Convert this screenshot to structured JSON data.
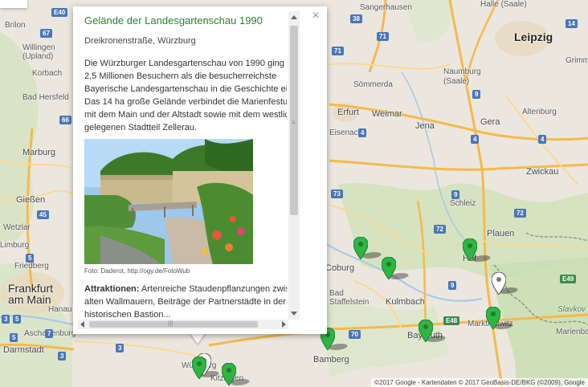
{
  "map": {
    "cities_major": [
      "Leipzig",
      "Frankfurt am Main"
    ],
    "cities": [
      "Erfurt",
      "Weimar",
      "Jena",
      "Gera",
      "Zwickau",
      "Plauen",
      "Hof",
      "Coburg",
      "Kulmbach",
      "Bayreuth",
      "Bamberg",
      "Marburg",
      "Gießen",
      "Darmstadt",
      "Naumburg (Saale)",
      "Halle (Saale)",
      "Sangerhausen",
      "Grimma",
      "Altenburg",
      "Marktredwitz",
      "Kitzingen",
      "Würzburg",
      "Brilon",
      "Willingen (Upland)",
      "Korbach",
      "Bad Staffelstein",
      "Friedberg",
      "Hanau",
      "Wetzlar",
      "Limburg",
      "Aschaffenburg",
      "Marienbad",
      "Slavkov",
      "Bad Hersfeld",
      "Eisenach",
      "Sömmerda",
      "Schleiz"
    ],
    "road_shields": [
      "71",
      "71",
      "9",
      "9",
      "9",
      "4",
      "4",
      "4",
      "72",
      "72",
      "73",
      "5",
      "5",
      "5",
      "3",
      "3",
      "3",
      "7",
      "70",
      "E48",
      "E49",
      "45",
      "66",
      "38",
      "14",
      "67",
      "E40"
    ],
    "copyright": "©2017 Google - Kartendaten © 2017 GeoBasis-DE/BKG (©2009), Google",
    "markers_count": 10
  },
  "infowindow": {
    "title": "Gelände der Landesgartenschau 1990",
    "address": "Dreikronenstraße, Würzburg",
    "description": "Die Würzburger Landesgartenschau von 1990 ging mit 2,5 Millionen Besuchern als die besucherreichste Bayerische Landesgartenschau in die Geschichte ein. Das 14 ha große Gelände verbindet die Marienfestung mit dem Main und der Altstadt sowie mit dem westlich gelegenen Stadtteil Zellerau.",
    "photo_alt": "Gelände der Landesgartenschau",
    "photo_credit": "Foto: Daderot, http://ogy.de/FotoWub",
    "attractions_label": "Attraktionen:",
    "attractions_text": "Artenreiche Staudenpflanzungen zwischen alten Wallmauern, Beiträge der Partnerstädte in der historischen Bastion...",
    "close_symbol": "×"
  },
  "colors": {
    "title_green": "#2e7d32",
    "marker_green": "#2fb543",
    "marker_white": "#ffffff",
    "map_bg": "#e9e5dc",
    "forest": "#cde0b8",
    "road_orange": "#f5b94c"
  }
}
